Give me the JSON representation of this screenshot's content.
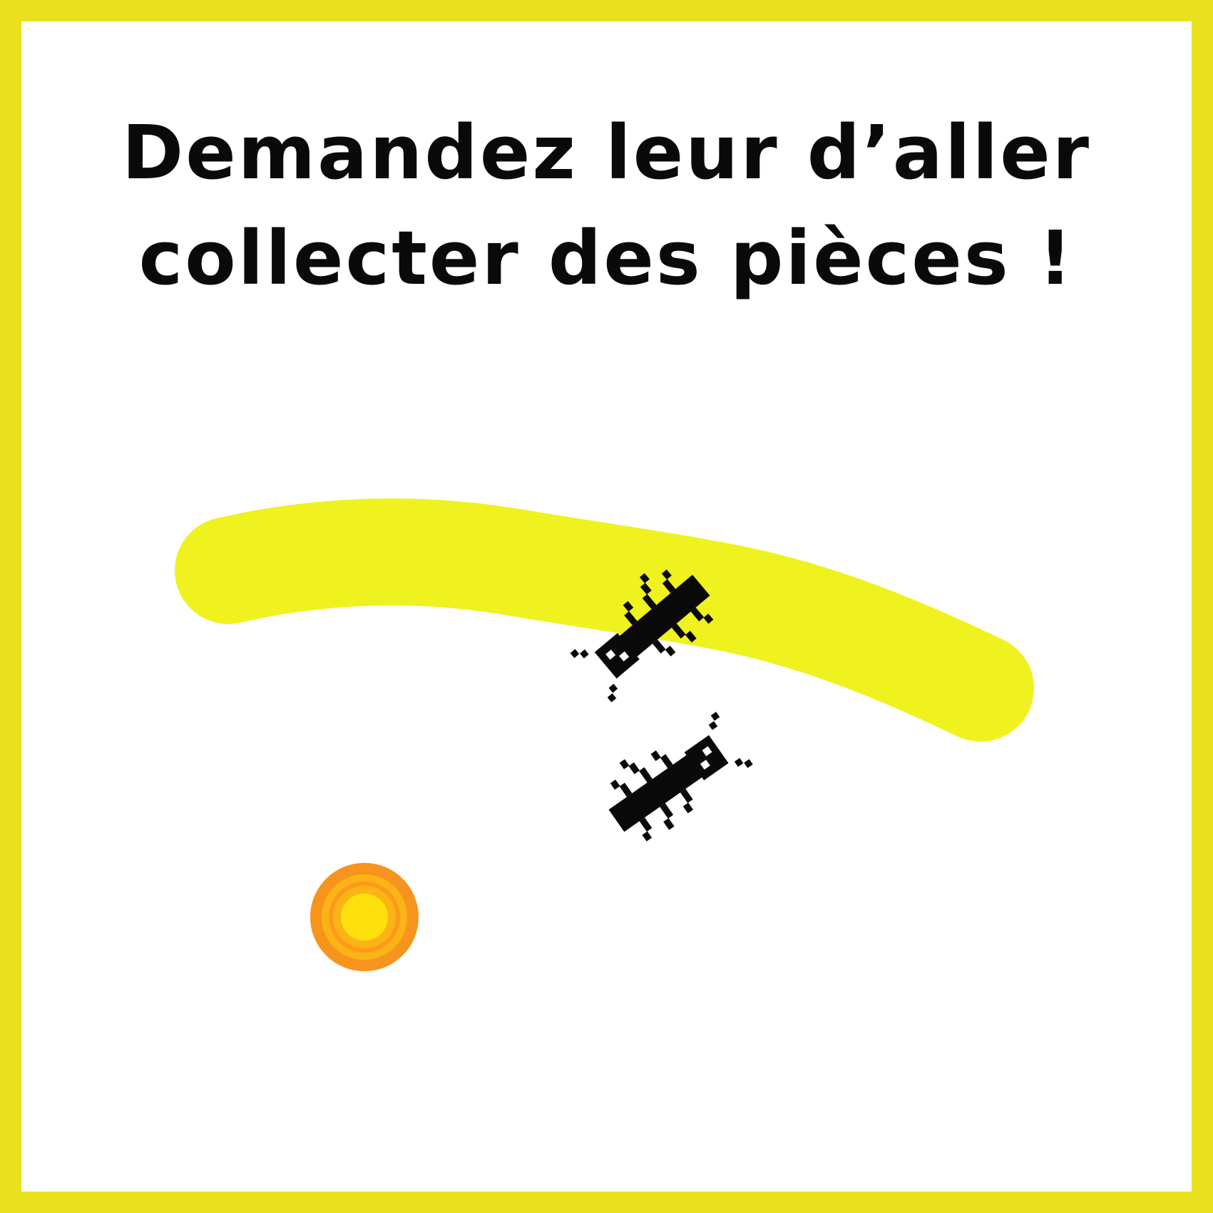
{
  "instruction": {
    "line1": "Demandez leur d’aller",
    "line2": "collecter des pièces !"
  },
  "colors": {
    "frame": "#e9e01e",
    "background": "#ffffff",
    "trail": "#eff21f",
    "ant": "#0a0a0a",
    "coin_outer": "#f7941d",
    "coin_ring": "#fbb416",
    "coin_inner": "#fde00d"
  },
  "sprites": {
    "ants": [
      "ant-icon",
      "ant-icon"
    ],
    "coin": "coin-icon",
    "trail": "paint-trail"
  }
}
